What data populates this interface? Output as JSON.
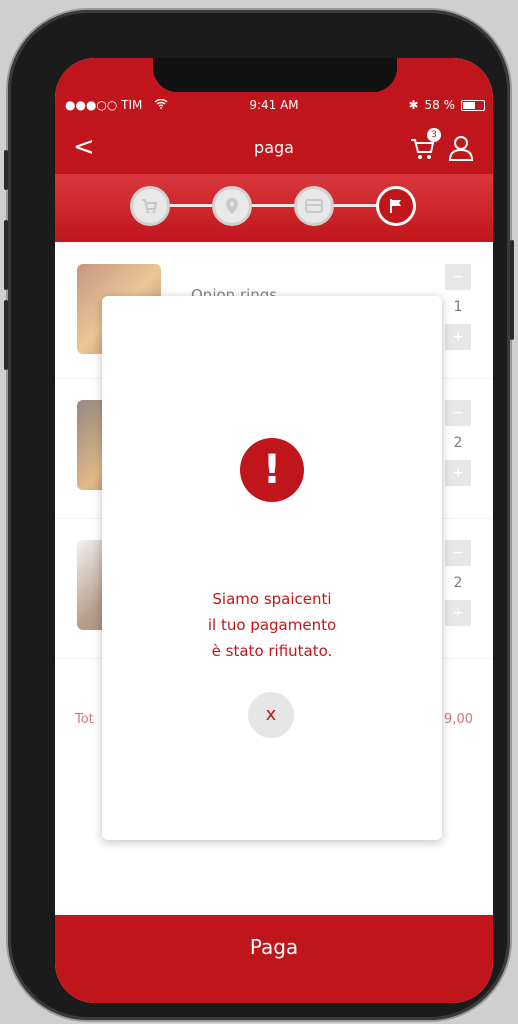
{
  "statusbar": {
    "carrier": "●●●○○ TIM",
    "time": "9:41 AM",
    "battery": "58 %"
  },
  "nav": {
    "title": "paga",
    "back": "<",
    "cart_count": "3"
  },
  "steps": [
    {
      "name": "cart-icon",
      "active": false
    },
    {
      "name": "location-icon",
      "active": false
    },
    {
      "name": "card-icon",
      "active": false
    },
    {
      "name": "flag-icon",
      "active": true
    }
  ],
  "items": [
    {
      "name": "Onion rings",
      "qty": "1"
    },
    {
      "name": "",
      "qty": "2"
    },
    {
      "name": "",
      "qty": "2"
    }
  ],
  "total": {
    "label": "Tot",
    "value": "9,00"
  },
  "modal": {
    "alert_symbol": "!",
    "message_line1": "Siamo spaicenti",
    "message_line2": "il tuo pagamento",
    "message_line3": "è stato rifiutato.",
    "close": "x"
  },
  "pay_button": "Paga",
  "colors": {
    "brand": "#c0161b"
  }
}
